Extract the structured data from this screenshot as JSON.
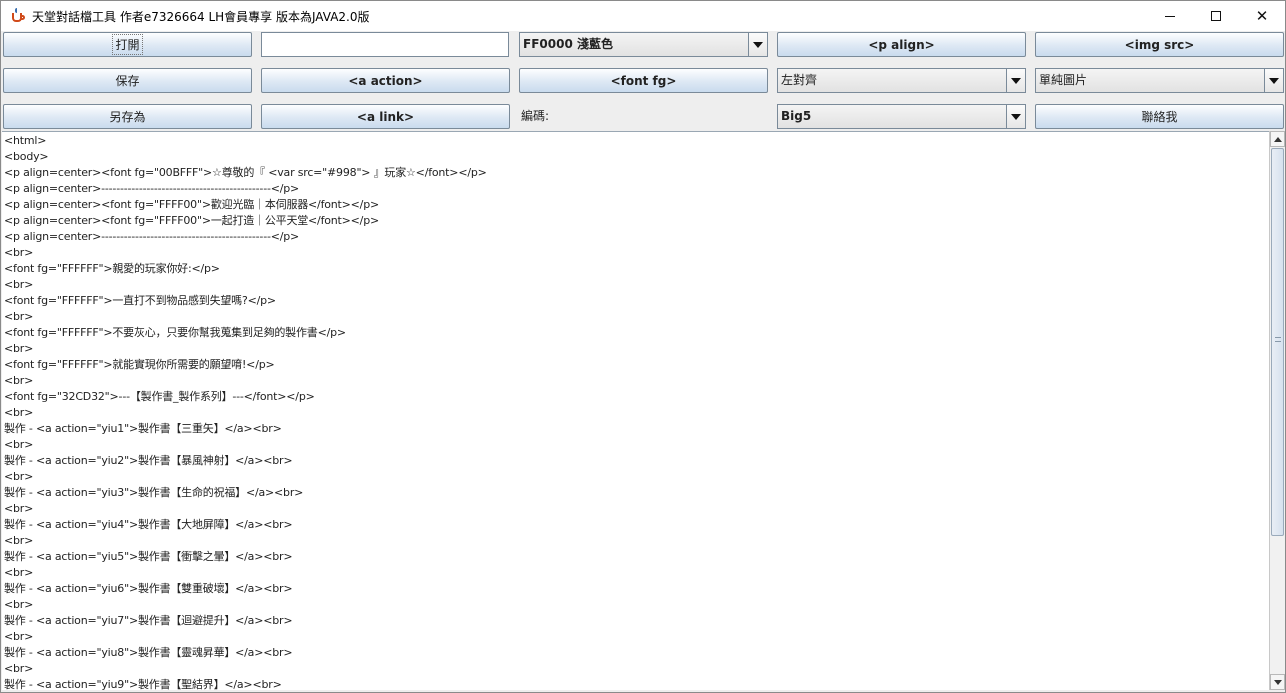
{
  "window": {
    "title": "天堂對話檔工具 作者e7326664  LH會員專享 版本為JAVA2.0版",
    "controls": {
      "minimize": "",
      "maximize": "",
      "close": "✕"
    }
  },
  "toolbar": {
    "open_label": "打開",
    "save_label": "保存",
    "save_as_label": "另存為",
    "text_input_value": "",
    "a_action_label": "<a action>",
    "a_link_label": "<a link>",
    "color_select_value": "FF0000 淺藍色",
    "font_fg_label": "<font fg>",
    "encoding_label": "編碼:",
    "p_align_label": "<p align>",
    "align_select_value": "左對齊",
    "encoding_select_value": "Big5",
    "img_src_label": "<img src>",
    "image_select_value": "單純圖片",
    "contact_label": "聯絡我"
  },
  "editor": {
    "lines": [
      "<html>",
      "<body>",
      "<p align=center><font fg=\"00BFFF\">☆尊敬的『 <var src=\"#998\"> 』玩家☆</font></p>",
      "<p align=center>---------------------------------------------</p>",
      "<p align=center><font fg=\"FFFF00\">歡迎光臨｜本伺服器</font></p>",
      "<p align=center><font fg=\"FFFF00\">一起打造｜公平天堂</font></p>",
      "<p align=center>---------------------------------------------</p>",
      "<br>",
      "<font fg=\"FFFFFF\">親愛的玩家你好:</p>",
      "<br>",
      "<font fg=\"FFFFFF\">一直打不到物品感到失望嗎?</p>",
      "<br>",
      "<font fg=\"FFFFFF\">不要灰心，只要你幫我蒐集到足夠的製作書</p>",
      "<br>",
      "<font fg=\"FFFFFF\">就能實現你所需要的願望唷!</p>",
      "<br>",
      "<font fg=\"32CD32\">---【製作書_製作系列】---</font></p>",
      "<br>",
      "製作 - <a action=\"yiu1\">製作書【三重矢】</a><br>",
      "<br>",
      "製作 - <a action=\"yiu2\">製作書【暴風神射】</a><br>",
      "<br>",
      "製作 - <a action=\"yiu3\">製作書【生命的祝福】</a><br>",
      "<br>",
      "製作 - <a action=\"yiu4\">製作書【大地屏障】</a><br>",
      "<br>",
      "製作 - <a action=\"yiu5\">製作書【衝擊之暈】</a><br>",
      "<br>",
      "製作 - <a action=\"yiu6\">製作書【雙重破壞】</a><br>",
      "<br>",
      "製作 - <a action=\"yiu7\">製作書【迴避提升】</a><br>",
      "<br>",
      "製作 - <a action=\"yiu8\">製作書【靈魂昇華】</a><br>",
      "<br>",
      "製作 - <a action=\"yiu9\">製作書【聖結界】</a><br>"
    ]
  },
  "icons": {
    "app": "java-cup-icon",
    "minimize": "minimize-icon",
    "maximize": "maximize-icon",
    "close": "close-icon",
    "dropdown": "chevron-down-icon"
  }
}
